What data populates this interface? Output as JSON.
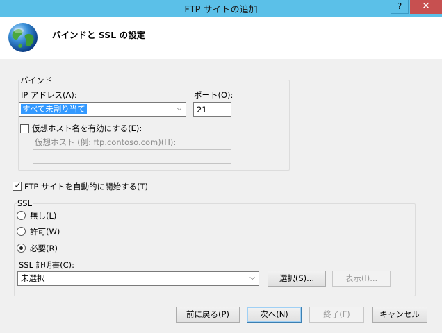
{
  "window": {
    "title": "FTP サイトの追加",
    "help_label": "?",
    "close_label": "✕"
  },
  "header": {
    "title": "バインドと SSL の設定"
  },
  "binding": {
    "group_label": "バインド",
    "ip_label": "IP アドレス(A):",
    "ip_value": "すべて未割り当て",
    "port_label": "ポート(O):",
    "port_value": "21",
    "vhost_checkbox_label": "仮想ホスト名を有効にする(E):",
    "vhost_checked": false,
    "vhost_field_label": "仮想ホスト (例: ftp.contoso.com)(H):",
    "vhost_value": ""
  },
  "autostart": {
    "label": "FTP サイトを自動的に開始する(T)",
    "checked": true
  },
  "ssl": {
    "group_label": "SSL",
    "options": [
      "無し(L)",
      "許可(W)",
      "必要(R)"
    ],
    "selected": "必要(R)",
    "cert_label": "SSL 証明書(C):",
    "cert_value": "未選択",
    "select_button": "選択(S)...",
    "view_button": "表示(I)..."
  },
  "footer": {
    "back": "前に戻る(P)",
    "next": "次へ(N)",
    "finish": "終了(F)",
    "cancel": "キャンセル"
  }
}
